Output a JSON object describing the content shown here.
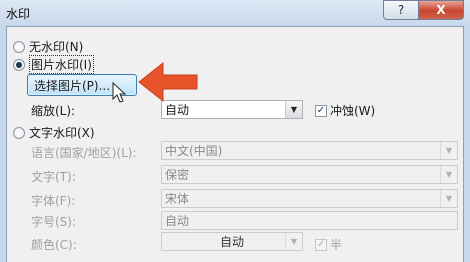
{
  "window": {
    "title": "水印",
    "help_label": "?",
    "close_label": "X"
  },
  "no_watermark": {
    "label": "无水印(N)"
  },
  "picture_watermark": {
    "label": "图片水印(I)",
    "select_button": "选择图片(P)...",
    "scale_label": "缩放(L):",
    "scale_value": "自动",
    "washout_label": "冲蚀(W)",
    "washout_checked": true
  },
  "text_watermark": {
    "label": "文字水印(X)",
    "language_label": "语言(国家/地区)(L):",
    "language_value": "中文(中国)",
    "text_label": "文字(T):",
    "text_value": "保密",
    "font_label": "字体(F):",
    "font_value": "宋体",
    "size_label": "字号(S):",
    "size_value": "自动",
    "color_label": "颜色(C):",
    "color_value": "自动",
    "semi_transparent_label": "半",
    "semi_transparent_checked": true
  },
  "icons": {
    "annotation_arrow": "orange-left-arrow",
    "mouse_cursor": "pointer-cursor"
  },
  "colors": {
    "accent_arrow": "#e8542a",
    "button_border": "#3c7fb1"
  }
}
